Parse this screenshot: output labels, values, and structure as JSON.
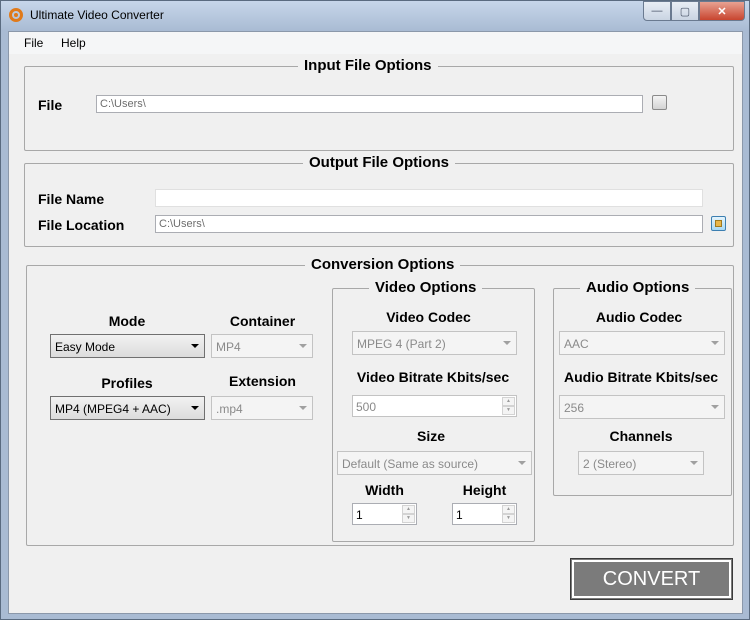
{
  "window": {
    "title": "Ultimate Video Converter",
    "minimize_glyph": "—",
    "maximize_glyph": "▢",
    "close_glyph": "✕"
  },
  "menu": {
    "file": "File",
    "help": "Help"
  },
  "input_group": {
    "title": "Input File Options",
    "file_label": "File",
    "file_value": "C:\\Users\\"
  },
  "output_group": {
    "title": "Output File Options",
    "name_label": "File Name",
    "name_value": "",
    "location_label": "File Location",
    "location_value": "C:\\Users\\"
  },
  "conversion_group": {
    "title": "Conversion Options",
    "mode_label": "Mode",
    "mode_value": "Easy Mode",
    "container_label": "Container",
    "container_value": "MP4",
    "profiles_label": "Profiles",
    "profiles_value": "MP4 (MPEG4 + AAC)",
    "extension_label": "Extension",
    "extension_value": ".mp4"
  },
  "video_group": {
    "title": "Video Options",
    "codec_label": "Video Codec",
    "codec_value": "MPEG 4 (Part 2)",
    "bitrate_label": "Video Bitrate Kbits/sec",
    "bitrate_value": "500",
    "size_label": "Size",
    "size_value": "Default (Same as source)",
    "width_label": "Width",
    "width_value": "1",
    "height_label": "Height",
    "height_value": "1"
  },
  "audio_group": {
    "title": "Audio Options",
    "codec_label": "Audio Codec",
    "codec_value": "AAC",
    "bitrate_label": "Audio Bitrate Kbits/sec",
    "bitrate_value": "256",
    "channels_label": "Channels",
    "channels_value": "2 (Stereo)"
  },
  "convert_label": "CONVERT",
  "colors": {
    "accent_orange": "#e07a1a",
    "convert_bg": "#7b7b7b",
    "close_red": "#c8452f"
  }
}
